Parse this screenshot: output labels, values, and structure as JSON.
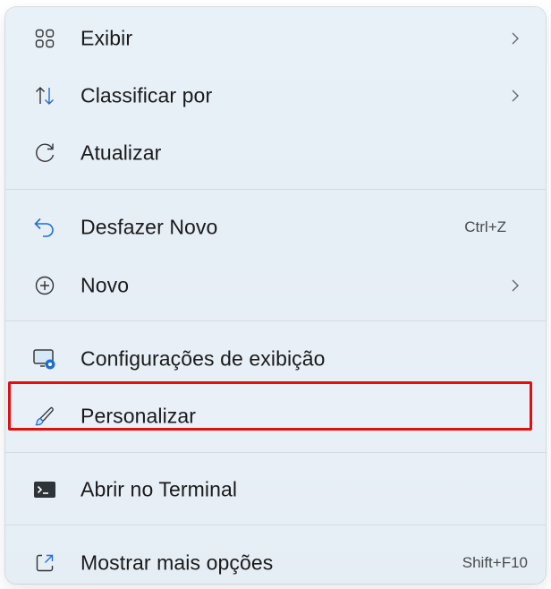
{
  "menu": {
    "items": [
      {
        "label": "Exibir",
        "icon": "grid-icon",
        "has_submenu": true
      },
      {
        "label": "Classificar por",
        "icon": "sort-icon",
        "has_submenu": true
      },
      {
        "label": "Atualizar",
        "icon": "refresh-icon",
        "has_submenu": false
      },
      {
        "label": "Desfazer Novo",
        "icon": "undo-icon",
        "shortcut": "Ctrl+Z"
      },
      {
        "label": "Novo",
        "icon": "add-circle-icon",
        "has_submenu": true
      },
      {
        "label": "Configurações de exibição",
        "icon": "display-settings-icon"
      },
      {
        "label": "Personalizar",
        "icon": "brush-icon",
        "highlighted": true
      },
      {
        "label": "Abrir no Terminal",
        "icon": "terminal-icon"
      },
      {
        "label": "Mostrar mais opções",
        "icon": "expand-icon",
        "shortcut": "Shift+F10"
      }
    ]
  },
  "colors": {
    "highlight_border": "#e01010",
    "accent_blue": "#1f6fd1",
    "menu_background": "#e8f0f7"
  }
}
